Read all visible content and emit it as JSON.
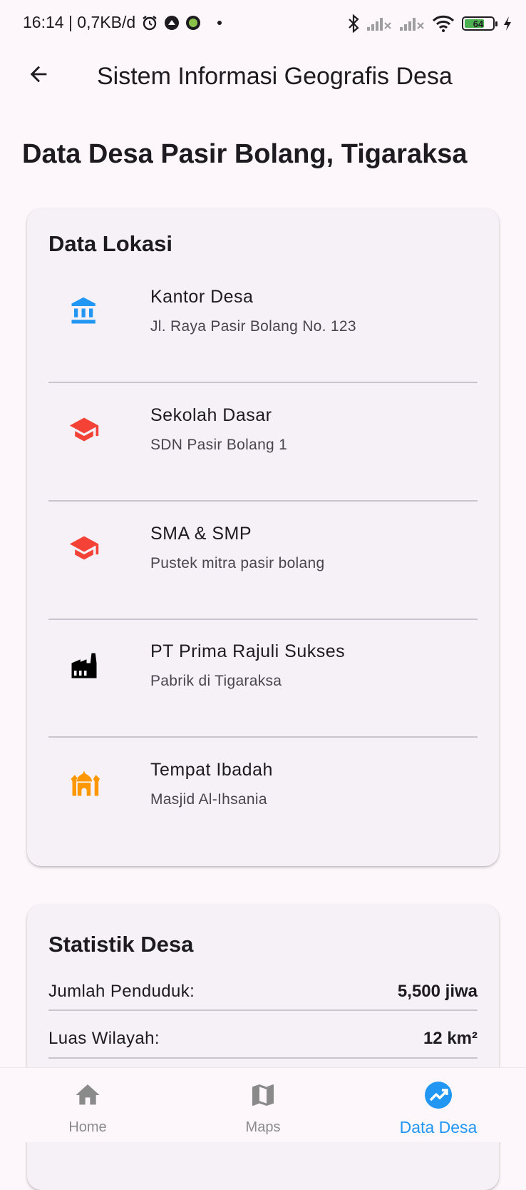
{
  "status_bar": {
    "time_speed": "16:14 | 0,7KB/d",
    "battery": "64",
    "icons": [
      "alarm-icon",
      "app-notification-icon",
      "whatsapp-icon",
      "dot-icon",
      "bluetooth-icon",
      "signal-icon",
      "signal-icon",
      "wifi-icon",
      "battery-icon",
      "charging-icon"
    ]
  },
  "app_bar": {
    "title": "Sistem Informasi Geografis Desa",
    "back_icon": "arrow-back-icon"
  },
  "page": {
    "heading": "Data Desa Pasir Bolang, Tigaraksa"
  },
  "locations": {
    "title": "Data Lokasi",
    "items": [
      {
        "name": "Kantor Desa",
        "detail": "Jl. Raya Pasir Bolang No. 123",
        "icon": "bank-icon",
        "color": "#2196f3"
      },
      {
        "name": "Sekolah Dasar",
        "detail": "SDN Pasir Bolang 1",
        "icon": "school-icon",
        "color": "#f44336"
      },
      {
        "name": "SMA & SMP",
        "detail": "Pustek mitra pasir bolang",
        "icon": "school-icon",
        "color": "#f44336"
      },
      {
        "name": "PT Prima Rajuli Sukses",
        "detail": "Pabrik di Tigaraksa",
        "icon": "factory-icon",
        "color": "#000000"
      },
      {
        "name": "Tempat Ibadah",
        "detail": "Masjid Al-Ihsania",
        "icon": "mosque-icon",
        "color": "#ff9800"
      }
    ]
  },
  "statistics": {
    "title": "Statistik Desa",
    "rows": [
      {
        "label": "Jumlah Penduduk:",
        "value": "5,500 jiwa"
      },
      {
        "label": "Luas Wilayah:",
        "value": "12 km²"
      }
    ]
  },
  "bottom_nav": {
    "items": [
      {
        "label": "Home",
        "icon": "home-icon",
        "active": false
      },
      {
        "label": "Maps",
        "icon": "map-icon",
        "active": false
      },
      {
        "label": "Data Desa",
        "icon": "trending-up-icon",
        "active": true
      }
    ],
    "active_color": "#2196f3",
    "inactive_color": "#8a8a8a"
  }
}
